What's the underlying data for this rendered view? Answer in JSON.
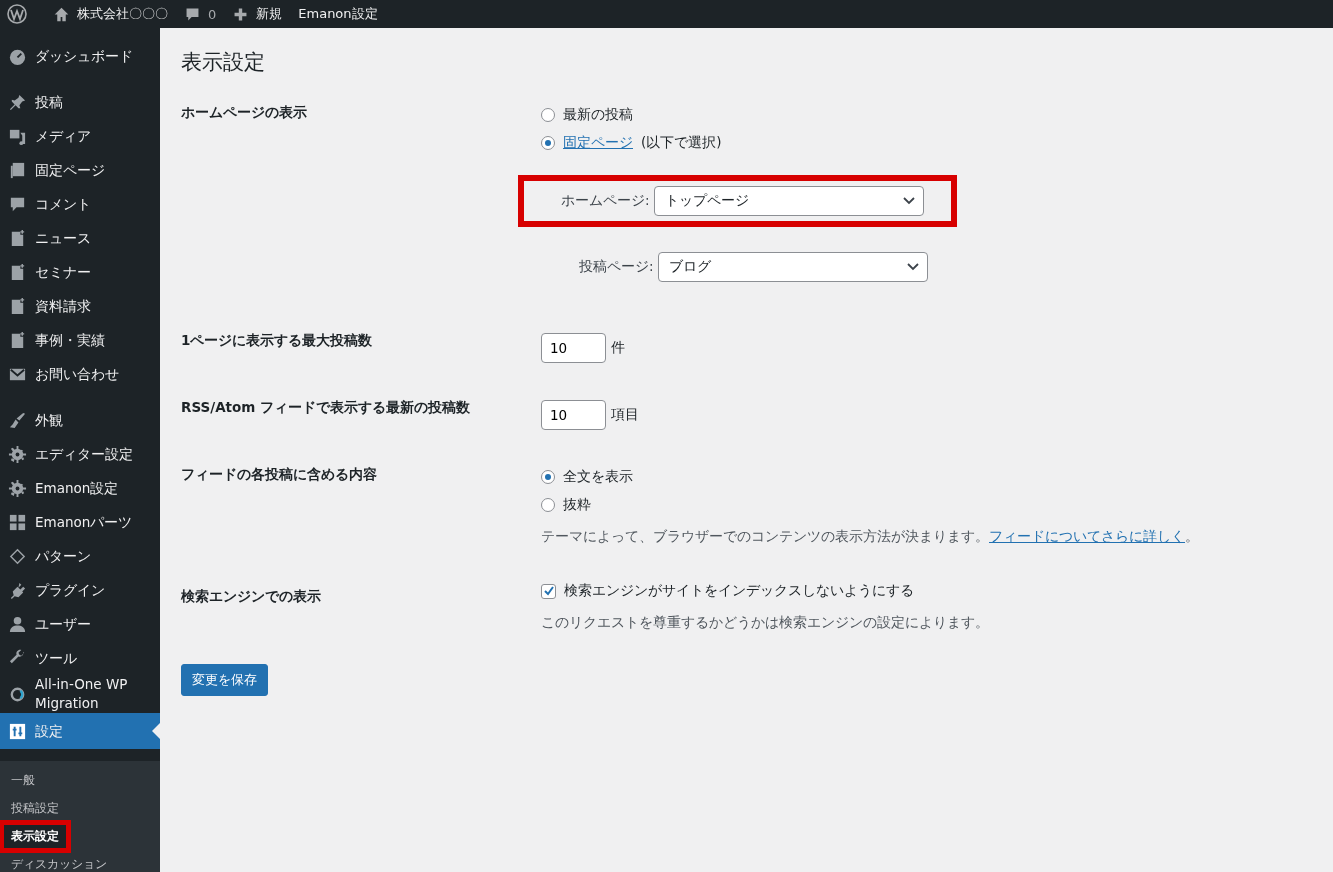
{
  "admin_bar": [
    {
      "kind": "logo"
    },
    {
      "kind": "home",
      "label": "株式会社〇〇〇"
    },
    {
      "kind": "comments",
      "label": "0"
    },
    {
      "kind": "new",
      "label": "新規"
    },
    {
      "kind": "text",
      "label": "Emanon設定"
    }
  ],
  "sidebar": {
    "groups": [
      [
        {
          "kind": "dashboard",
          "label": "ダッシュボード",
          "current": false
        }
      ],
      [
        {
          "kind": "pin",
          "label": "投稿",
          "current": false
        },
        {
          "kind": "media",
          "label": "メディア",
          "current": false
        },
        {
          "kind": "pages",
          "label": "固定ページ",
          "current": false
        },
        {
          "kind": "comment",
          "label": "コメント",
          "current": false
        },
        {
          "kind": "post-add",
          "label": "ニュース",
          "current": false
        },
        {
          "kind": "post-add",
          "label": "セミナー",
          "current": false
        },
        {
          "kind": "post-add",
          "label": "資料請求",
          "current": false
        },
        {
          "kind": "post-add",
          "label": "事例・実績",
          "current": false
        },
        {
          "kind": "mail",
          "label": "お問い合わせ",
          "current": false
        }
      ],
      [
        {
          "kind": "brush",
          "label": "外観",
          "current": false
        },
        {
          "kind": "gear",
          "label": "エディター設定",
          "current": false
        },
        {
          "kind": "gear",
          "label": "Emanon設定",
          "current": false
        },
        {
          "kind": "grid",
          "label": "Emanonパーツ",
          "current": false
        },
        {
          "kind": "diamond",
          "label": "パターン",
          "current": false
        },
        {
          "kind": "plug",
          "label": "プラグイン",
          "current": false
        },
        {
          "kind": "user",
          "label": "ユーザー",
          "current": false
        },
        {
          "kind": "wrench",
          "label": "ツール",
          "current": false
        },
        {
          "kind": "circle",
          "label": "All-in-One WP Migration",
          "current": false
        },
        {
          "kind": "sliders",
          "label": "設定",
          "current": true
        }
      ]
    ],
    "submenu": [
      {
        "label": "一般",
        "selected": false,
        "highlighted": false
      },
      {
        "label": "投稿設定",
        "selected": false,
        "highlighted": false
      },
      {
        "label": "表示設定",
        "selected": true,
        "highlighted": true
      },
      {
        "label": "ディスカッション",
        "selected": false,
        "highlighted": false
      }
    ]
  },
  "page": {
    "title": "表示設定",
    "rows": [
      {
        "kind": "front_page",
        "label": "ホームページの表示",
        "options": [
          {
            "label": "最新の投稿",
            "selected": false
          },
          {
            "link": "固定ページ",
            "label": "(以下で選択)",
            "selected": true
          }
        ],
        "selects": [
          {
            "label": "ホームページ:",
            "value": "トップページ",
            "highlighted": true
          },
          {
            "label": "投稿ページ:",
            "value": "ブログ",
            "highlighted": false
          }
        ]
      },
      {
        "kind": "number",
        "label": "1ページに表示する最大投稿数",
        "value": "10",
        "unit": "件"
      },
      {
        "kind": "number",
        "label": "RSS/Atom フィードで表示する最新の投稿数",
        "value": "10",
        "unit": "項目"
      },
      {
        "kind": "radios",
        "label": "フィードの各投稿に含める内容",
        "options": [
          {
            "label": "全文を表示",
            "selected": true
          },
          {
            "label": "抜粋",
            "selected": false
          }
        ],
        "description": "テーマによって、ブラウザーでのコンテンツの表示方法が決まります。",
        "description_link": "フィードについてさらに詳しく",
        "description_end": "。"
      },
      {
        "kind": "checkbox",
        "label": "検索エンジンでの表示",
        "checkbox_label": "検索エンジンがサイトをインデックスしないようにする",
        "checked": true,
        "description": "このリクエストを尊重するかどうかは検索エンジンの設定によります。"
      }
    ],
    "save_button": "変更を保存"
  }
}
